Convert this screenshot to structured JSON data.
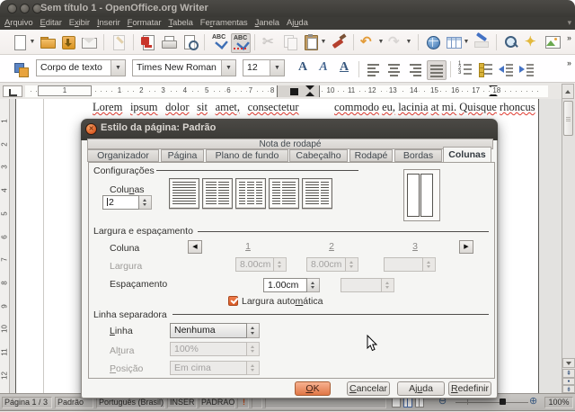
{
  "window": {
    "title": "Sem título 1 - OpenOffice.org Writer"
  },
  "menubar": {
    "items": [
      {
        "name": "arquivo",
        "pre": "",
        "key": "A",
        "post": "rquivo"
      },
      {
        "name": "editar",
        "pre": "",
        "key": "E",
        "post": "ditar"
      },
      {
        "name": "exibir",
        "pre": "E",
        "key": "x",
        "post": "ibir"
      },
      {
        "name": "inserir",
        "pre": "",
        "key": "I",
        "post": "nserir"
      },
      {
        "name": "formatar",
        "pre": "",
        "key": "F",
        "post": "ormatar"
      },
      {
        "name": "tabela",
        "pre": "",
        "key": "T",
        "post": "abela"
      },
      {
        "name": "ferramentas",
        "pre": "Fe",
        "key": "r",
        "post": "ramentas"
      },
      {
        "name": "janela",
        "pre": "",
        "key": "J",
        "post": "anela"
      },
      {
        "name": "ajuda",
        "pre": "Aj",
        "key": "u",
        "post": "da"
      }
    ]
  },
  "toolbar_main": {
    "items": [
      {
        "name": "new-document-icon",
        "icon": "new",
        "dd": true
      },
      {
        "name": "open-icon",
        "icon": "open"
      },
      {
        "name": "save-icon",
        "icon": "save"
      },
      {
        "name": "email-icon",
        "icon": "email"
      },
      {
        "sep": true
      },
      {
        "name": "edit-file-icon",
        "icon": "editfile",
        "dis": true
      },
      {
        "sep": true
      },
      {
        "name": "export-pdf-icon",
        "icon": "pdf"
      },
      {
        "name": "print-icon",
        "icon": "print"
      },
      {
        "name": "page-preview-icon",
        "icon": "preview"
      },
      {
        "sep": true
      },
      {
        "name": "spellcheck-icon",
        "icon": "spell"
      },
      {
        "name": "autospellcheck-icon",
        "icon": "autospell",
        "pressed": true
      },
      {
        "sep": true
      },
      {
        "name": "cut-icon",
        "icon": "cut",
        "dis": true
      },
      {
        "name": "copy-icon",
        "icon": "copy",
        "dis": true
      },
      {
        "name": "paste-icon",
        "icon": "paste",
        "dd": true
      },
      {
        "name": "format-paintbrush-icon",
        "icon": "brush"
      },
      {
        "sep": true
      },
      {
        "name": "undo-icon",
        "icon": "undo",
        "dd": true
      },
      {
        "name": "redo-icon",
        "icon": "redo",
        "dis": true,
        "dd": true
      },
      {
        "sep": true
      },
      {
        "name": "hyperlink-icon",
        "icon": "globe"
      },
      {
        "name": "table-icon",
        "icon": "table",
        "dd": true
      },
      {
        "name": "draw-functions-icon",
        "icon": "draw"
      },
      {
        "sep": true
      },
      {
        "name": "find-replace-icon",
        "icon": "find"
      },
      {
        "name": "navigator-icon",
        "icon": "nav"
      },
      {
        "name": "gallery-icon",
        "icon": "gallery"
      }
    ]
  },
  "toolbar_format": {
    "style_value": "Corpo de texto",
    "font_value": "Times New Roman",
    "size_value": "12",
    "items": [
      {
        "name": "bold-icon",
        "icon": "bold",
        "glyph": "A"
      },
      {
        "name": "italic-icon",
        "icon": "italic",
        "glyph": "A"
      },
      {
        "name": "underline-icon",
        "icon": "under",
        "glyph": "A"
      },
      {
        "sep": true
      },
      {
        "name": "align-left-icon",
        "icon": "alignl"
      },
      {
        "name": "align-center-icon",
        "icon": "alignc"
      },
      {
        "name": "align-right-icon",
        "icon": "alignr"
      },
      {
        "name": "justify-icon",
        "icon": "justify",
        "pressed": true
      },
      {
        "sep": true
      },
      {
        "name": "numbered-list-icon",
        "icon": "numlist"
      },
      {
        "name": "bullet-list-icon",
        "icon": "bullist"
      },
      {
        "name": "decrease-indent-icon",
        "icon": "dec"
      },
      {
        "name": "increase-indent-icon",
        "icon": "inc"
      }
    ]
  },
  "hruler": {
    "box_label": "1",
    "left_numbers": [
      "1",
      "2",
      "3",
      "4",
      "5",
      "6",
      "7",
      "8"
    ],
    "right_numbers": [
      "10",
      "11",
      "12",
      "13",
      "14",
      "15",
      "16",
      "17",
      "18"
    ]
  },
  "vruler": {
    "numbers": [
      "1",
      "2",
      "3",
      "4",
      "5",
      "6",
      "7",
      "8",
      "9",
      "10",
      "11",
      "12"
    ]
  },
  "document": {
    "line_left": "Lorem ipsum dolor sit amet, consectetur",
    "line_right": "commodo eu, lacinia at mi. Quisque rhoncus"
  },
  "dialog": {
    "title": "Estilo da página: Padrão",
    "tabs_row1": [
      "Nota de rodapé"
    ],
    "tabs_row2": [
      "Organizador",
      "Página",
      "Plano de fundo",
      "Cabeçalho",
      "Rodapé",
      "Bordas",
      "Colunas"
    ],
    "active_tab": "Colunas",
    "settings": {
      "label": "Configurações",
      "columns_label": {
        "pre": "Colu",
        "key": "n",
        "post": "as"
      },
      "columns_value": "2"
    },
    "width_group": {
      "label": "Largura e espaçamento",
      "column_label": "Coluna",
      "col_numbers": [
        {
          "pre": "",
          "key": "1",
          "post": ""
        },
        {
          "pre": "",
          "key": "2",
          "post": ""
        },
        {
          "pre": "",
          "key": "3",
          "post": ""
        }
      ],
      "width_label": "Largura",
      "width_values": [
        "8.00cm",
        "8.00cm",
        ""
      ],
      "spacing_label": "Espaçamento",
      "spacing_values": [
        "1.00cm",
        ""
      ],
      "autowidth_label": {
        "pre": "Largura auto",
        "key": "m",
        "post": "ática"
      },
      "autowidth_checked": true
    },
    "separator_group": {
      "label": "Linha separadora",
      "line_label": {
        "pre": "",
        "key": "L",
        "post": "inha"
      },
      "line_value": "Nenhuma",
      "height_label": {
        "pre": "Al",
        "key": "t",
        "post": "ura"
      },
      "height_value": "100%",
      "position_label": {
        "pre": "",
        "key": "P",
        "post": "osição"
      },
      "position_value": "Em cima"
    },
    "buttons": {
      "ok": {
        "pre": "",
        "key": "O",
        "post": "K"
      },
      "cancel": {
        "pre": "",
        "key": "C",
        "post": "ancelar"
      },
      "help": {
        "pre": "Aj",
        "key": "u",
        "post": "da"
      },
      "reset": {
        "pre": "",
        "key": "R",
        "post": "edefinir"
      }
    }
  },
  "statusbar": {
    "page": "Página 1 / 3",
    "style": "Padrão",
    "language": "Português (Brasil)",
    "insert_mode": "INSER",
    "selection_mode": "PADRAO",
    "alert": "!",
    "zoom": "100%"
  }
}
